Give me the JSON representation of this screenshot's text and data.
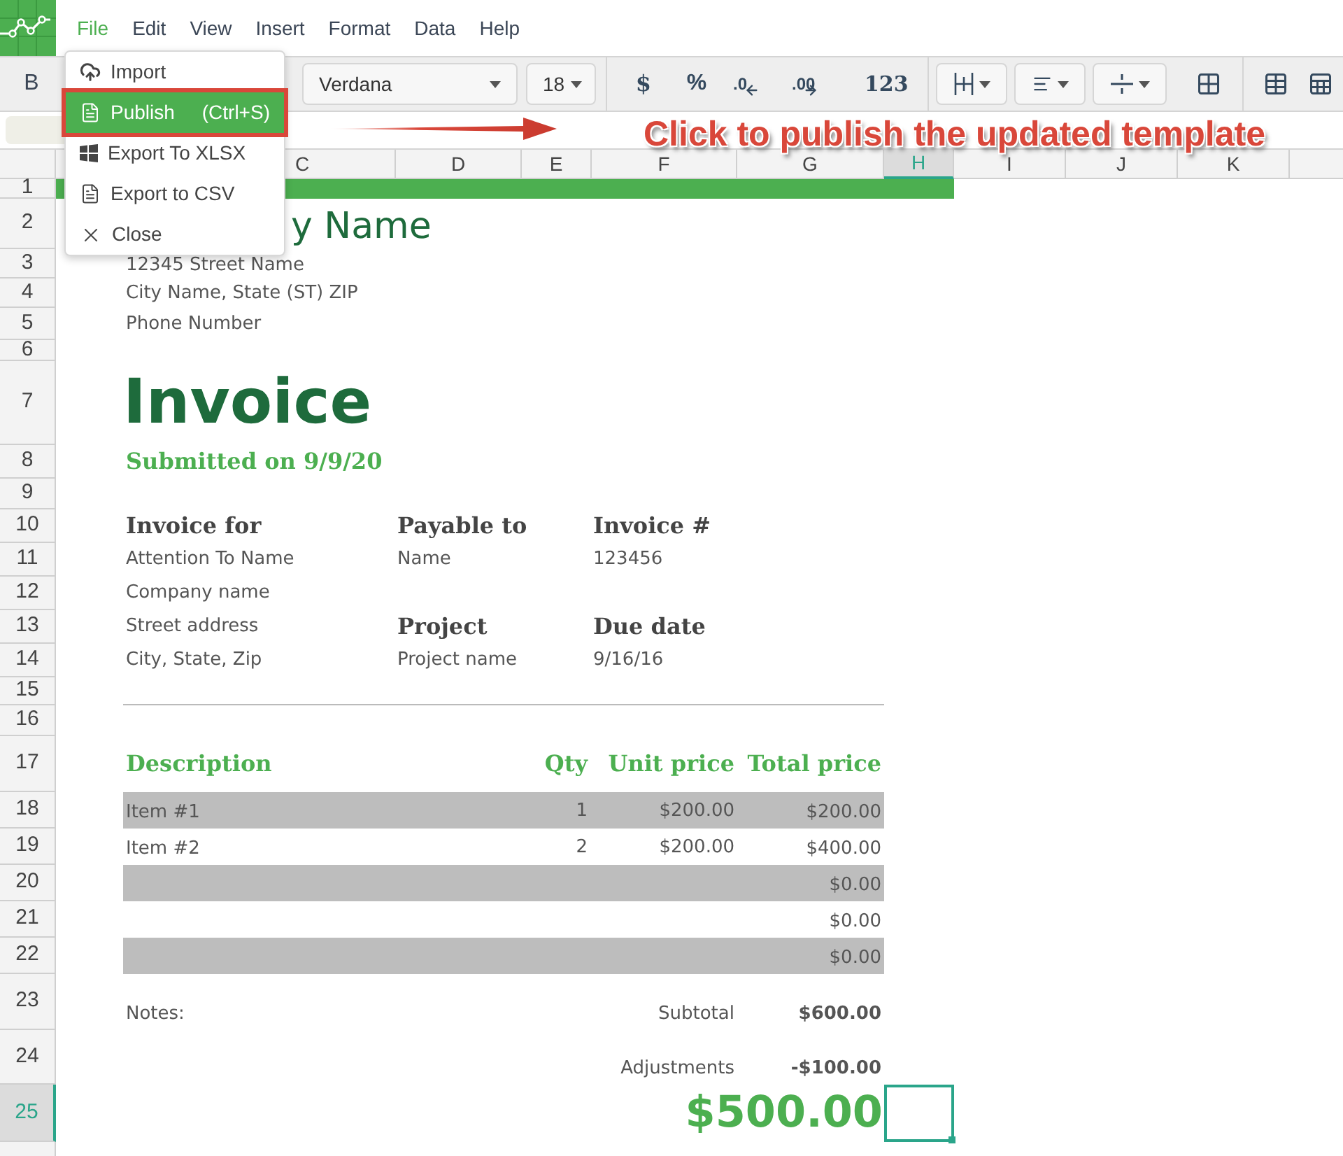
{
  "app_menu": [
    {
      "label": "File",
      "selected": true
    },
    {
      "label": "Edit",
      "selected": false
    },
    {
      "label": "View",
      "selected": false
    },
    {
      "label": "Insert",
      "selected": false
    },
    {
      "label": "Format",
      "selected": false
    },
    {
      "label": "Data",
      "selected": false
    },
    {
      "label": "Help",
      "selected": false
    }
  ],
  "file_menu": [
    {
      "kind": "upload",
      "label": "Import",
      "selected": false
    },
    {
      "kind": "document",
      "label": "Publish",
      "shortcut": "(Ctrl+S)",
      "selected": true
    },
    {
      "kind": "windows",
      "label": "Export To XLSX",
      "selected": false
    },
    {
      "kind": "document",
      "label": "Export to CSV",
      "selected": false
    },
    {
      "kind": "close",
      "label": "Close",
      "selected": false
    }
  ],
  "toolbar": {
    "bold": "B",
    "font": "Verdana",
    "font_size": "18",
    "currency": "$",
    "percent": "%",
    "decrease_decimals": ".0",
    "increase_decimals": ".00",
    "number_format": "123"
  },
  "annotation": "Click to publish the updated template",
  "column_headers": [
    {
      "label": "C",
      "selected": false
    },
    {
      "label": "D",
      "selected": false
    },
    {
      "label": "E",
      "selected": false
    },
    {
      "label": "F",
      "selected": false
    },
    {
      "label": "G",
      "selected": false
    },
    {
      "label": "H",
      "selected": true
    },
    {
      "label": "I",
      "selected": false
    },
    {
      "label": "J",
      "selected": false
    },
    {
      "label": "K",
      "selected": false
    }
  ],
  "row_headers": [
    {
      "label": "1",
      "selected": false
    },
    {
      "label": "2",
      "selected": false
    },
    {
      "label": "3",
      "selected": false
    },
    {
      "label": "4",
      "selected": false
    },
    {
      "label": "5",
      "selected": false
    },
    {
      "label": "6",
      "selected": false
    },
    {
      "label": "7",
      "selected": false
    },
    {
      "label": "8",
      "selected": false
    },
    {
      "label": "9",
      "selected": false
    },
    {
      "label": "10",
      "selected": false
    },
    {
      "label": "11",
      "selected": false
    },
    {
      "label": "12",
      "selected": false
    },
    {
      "label": "13",
      "selected": false
    },
    {
      "label": "14",
      "selected": false
    },
    {
      "label": "15",
      "selected": false
    },
    {
      "label": "16",
      "selected": false
    },
    {
      "label": "17",
      "selected": false
    },
    {
      "label": "18",
      "selected": false
    },
    {
      "label": "19",
      "selected": false
    },
    {
      "label": "20",
      "selected": false
    },
    {
      "label": "21",
      "selected": false
    },
    {
      "label": "22",
      "selected": false
    },
    {
      "label": "23",
      "selected": false
    },
    {
      "label": "24",
      "selected": false
    },
    {
      "label": "25",
      "selected": true
    }
  ],
  "invoice": {
    "company_name": "y Name",
    "address": [
      "12345  Street Name",
      "City Name,  State (ST) ZIP",
      "Phone Number"
    ],
    "title": "Invoice",
    "submitted": "Submitted on 9/9/20",
    "invoice_for": {
      "heading": "Invoice for",
      "lines": [
        "Attention To Name",
        "Company name",
        "Street address",
        "City, State, Zip"
      ]
    },
    "payable_to": {
      "heading": "Payable to",
      "value": "Name"
    },
    "invoice_number": {
      "heading": "Invoice #",
      "value": "123456"
    },
    "project": {
      "heading": "Project",
      "value": "Project name"
    },
    "due_date": {
      "heading": "Due date",
      "value": "9/16/16"
    },
    "columns": [
      "Description",
      "Qty",
      "Unit price",
      "Total price"
    ],
    "items": [
      {
        "description": "Item #1",
        "qty": "1",
        "unit_price": "$200.00",
        "total": "$200.00",
        "shaded": true
      },
      {
        "description": "Item #2",
        "qty": "2",
        "unit_price": "$200.00",
        "total": "$400.00",
        "shaded": false
      },
      {
        "total": "$0.00",
        "shaded": true
      },
      {
        "total": "$0.00",
        "shaded": false
      },
      {
        "total": "$0.00",
        "shaded": true
      }
    ],
    "notes_label": "Notes:",
    "subtotal_label": "Subtotal",
    "subtotal": "$600.00",
    "adjustments_label": "Adjustments",
    "adjustments": "-$100.00",
    "total": "$500.00"
  }
}
